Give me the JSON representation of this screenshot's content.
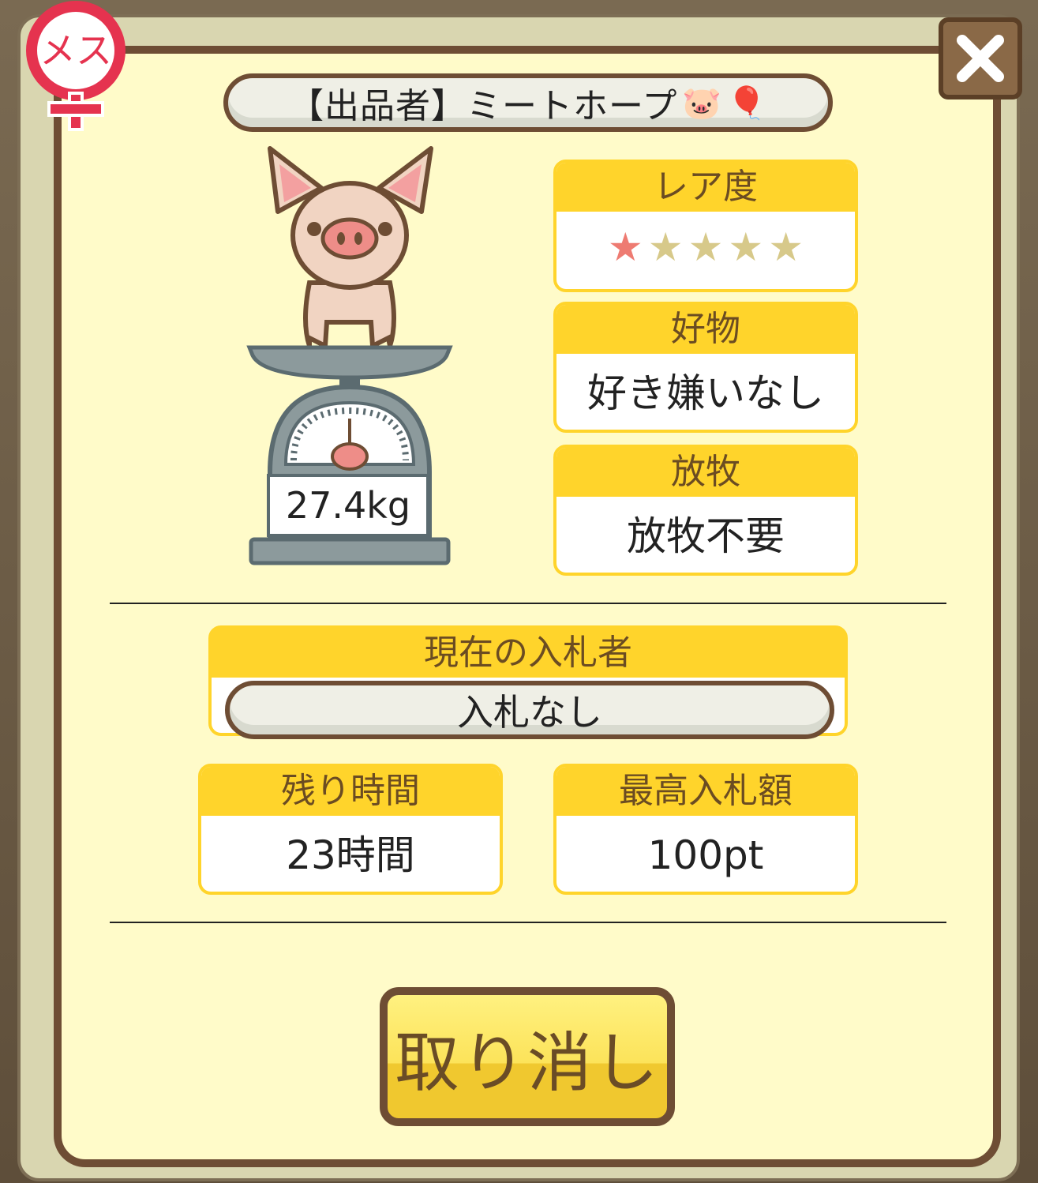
{
  "gender": {
    "label": "メス",
    "icon": "female-symbol-icon"
  },
  "seller": {
    "label": "【出品者】ミートホープ",
    "emoji_pig": "🐷",
    "emoji_balloon": "🎈"
  },
  "close": {
    "icon": "close-icon",
    "glyph": "✕"
  },
  "pig": {
    "icon": "pig-on-scale-icon",
    "weight": "27.4kg"
  },
  "rarity": {
    "label": "レア度",
    "value": 1,
    "max": 5,
    "star_on_color": "#ee7b72",
    "star_off_color": "#d7c98a"
  },
  "favorite": {
    "label": "好物",
    "value": "好き嫌いなし"
  },
  "grazing": {
    "label": "放牧",
    "value": "放牧不要"
  },
  "bidder": {
    "label": "現在の入札者",
    "value": "入札なし"
  },
  "remaining": {
    "label": "残り時間",
    "value": "23時間"
  },
  "highest_bid": {
    "label": "最高入札額",
    "value": "100pt"
  },
  "cancel": {
    "label": "取り消し"
  },
  "colors": {
    "panel_bg": "#fffbc9",
    "frame": "#6e4d34",
    "card_header": "#ffd42b",
    "button": "#fce35a"
  }
}
